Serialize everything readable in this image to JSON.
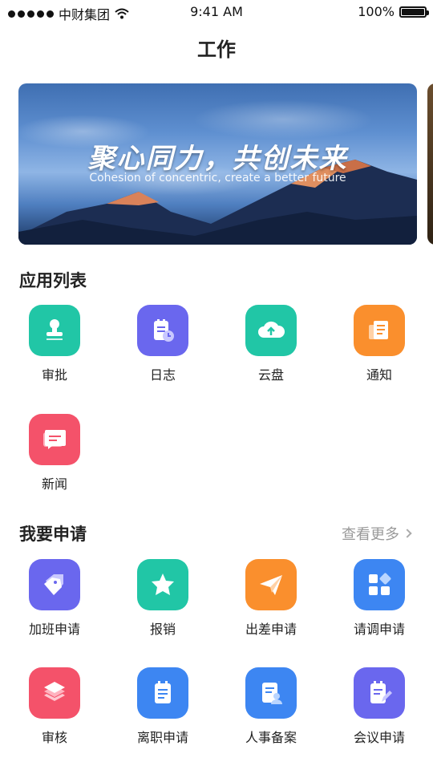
{
  "status": {
    "carrier": "中财集团",
    "time": "9:41 AM",
    "battery": "100%"
  },
  "nav": {
    "title": "工作"
  },
  "banner": {
    "title": "聚心同力，共创未来",
    "subtitle": "Cohesion of concentric, create a better future"
  },
  "apps": {
    "title": "应用列表",
    "items": [
      {
        "label": "审批",
        "icon": "stamp-icon",
        "color": "#21c6a6"
      },
      {
        "label": "日志",
        "icon": "log-icon",
        "color": "#6a67ee"
      },
      {
        "label": "云盘",
        "icon": "cloud-upload-icon",
        "color": "#21c6a6"
      },
      {
        "label": "通知",
        "icon": "notice-icon",
        "color": "#fa8f2d"
      },
      {
        "label": "新闻",
        "icon": "message-icon",
        "color": "#f4526a"
      }
    ]
  },
  "requests": {
    "title": "我要申请",
    "more": "查看更多",
    "items": [
      {
        "label": "加班申请",
        "icon": "tag-icon",
        "color": "#6a67ee"
      },
      {
        "label": "报销",
        "icon": "star-icon",
        "color": "#21c6a6"
      },
      {
        "label": "出差申请",
        "icon": "paper-plane-icon",
        "color": "#fa8f2d"
      },
      {
        "label": "请调申请",
        "icon": "grid-icon",
        "color": "#3d86f2"
      },
      {
        "label": "审核",
        "icon": "layers-icon",
        "color": "#f4526a"
      },
      {
        "label": "离职申请",
        "icon": "clipboard-icon",
        "color": "#3d86f2"
      },
      {
        "label": "人事备案",
        "icon": "person-file-icon",
        "color": "#3d86f2"
      },
      {
        "label": "会议申请",
        "icon": "edit-doc-icon",
        "color": "#6a67ee"
      }
    ]
  }
}
